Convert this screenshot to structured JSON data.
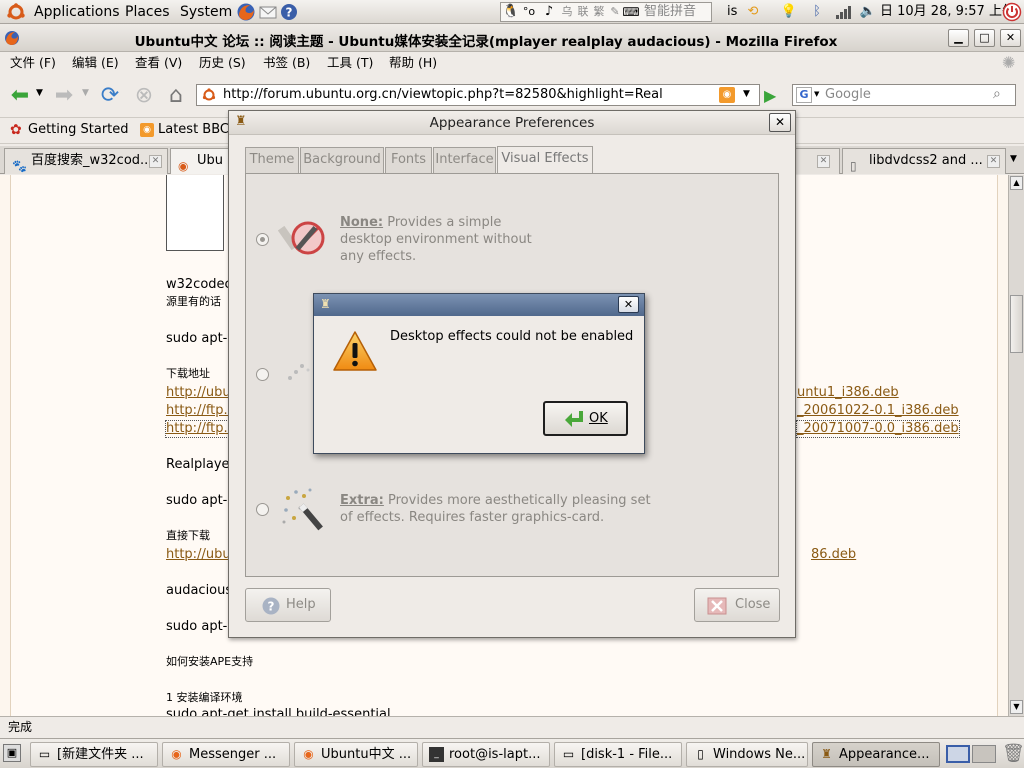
{
  "top_panel": {
    "menus": [
      "Applications",
      "Places",
      "System"
    ],
    "input_method": "智能拼音",
    "user": "is",
    "clock": "日 10月 28, 9:57 上午"
  },
  "firefox": {
    "title": "Ubuntu中文 论坛 :: 阅读主题 - Ubuntu媒体安装全记录(mplayer realplay audacious) - Mozilla Firefox",
    "menus": [
      "文件 (F)",
      "编辑 (E)",
      "查看 (V)",
      "历史 (S)",
      "书签 (B)",
      "工具 (T)",
      "帮助 (H)"
    ],
    "url": "http://forum.ubuntu.org.cn/viewtopic.php?t=82580&highlight=Real",
    "search_placeholder": "Google",
    "bookmarks": [
      "Getting Started",
      "Latest BBC"
    ],
    "tabs": [
      "百度搜索_w32cod...",
      "Ubu",
      "libdvdcss2 and ..."
    ],
    "status": "完成"
  },
  "page": {
    "lines": {
      "w32codec": "w32codec",
      "source_note": "源里有的话",
      "sudo1": "sudo apt-",
      "download_addr": "下载地址",
      "link1_left": "http://ubu",
      "link2_left": "http://ftp.s",
      "link3_left": "http://ftp.s",
      "link1_right": "untu1_i386.deb",
      "link2_right": "_20061022-0.1_i386.deb",
      "link3_right": "_20071007-0.0_i386.deb",
      "realplayer": "Realplayer",
      "sudo2": "sudo apt-",
      "direct_download": "直接下载",
      "link4_left": "http://ubu",
      "link4_right": "86.deb",
      "audacious": "audacious",
      "sudo3": "sudo apt-",
      "ape": "如何安装APE支持",
      "build_env": "1 安装编译环境",
      "build_cmd": "sudo apt-get install build-essential"
    }
  },
  "appearance": {
    "title": "Appearance Preferences",
    "tabs": [
      "Theme",
      "Background",
      "Fonts",
      "Interface",
      "Visual Effects"
    ],
    "none_title": "None:",
    "none_desc_1": "Provides a simple",
    "none_desc_2": "desktop environment without",
    "none_desc_3": "any effects.",
    "extra_title": "Extra:",
    "extra_desc_1": "Provides more aesthetically pleasing set",
    "extra_desc_2": "of effects. Requires faster graphics-card.",
    "help_label": "Help",
    "close_label": "Close"
  },
  "error_dialog": {
    "message": "Desktop effects could not be enabled",
    "ok_label": "OK"
  },
  "taskbar": {
    "items": [
      "[新建文件夹 ...",
      "Messenger ...",
      "Ubuntu中文 ...",
      "root@is-lapt...",
      "[disk-1 - File...",
      "Windows Ne...",
      "Appearance..."
    ]
  }
}
